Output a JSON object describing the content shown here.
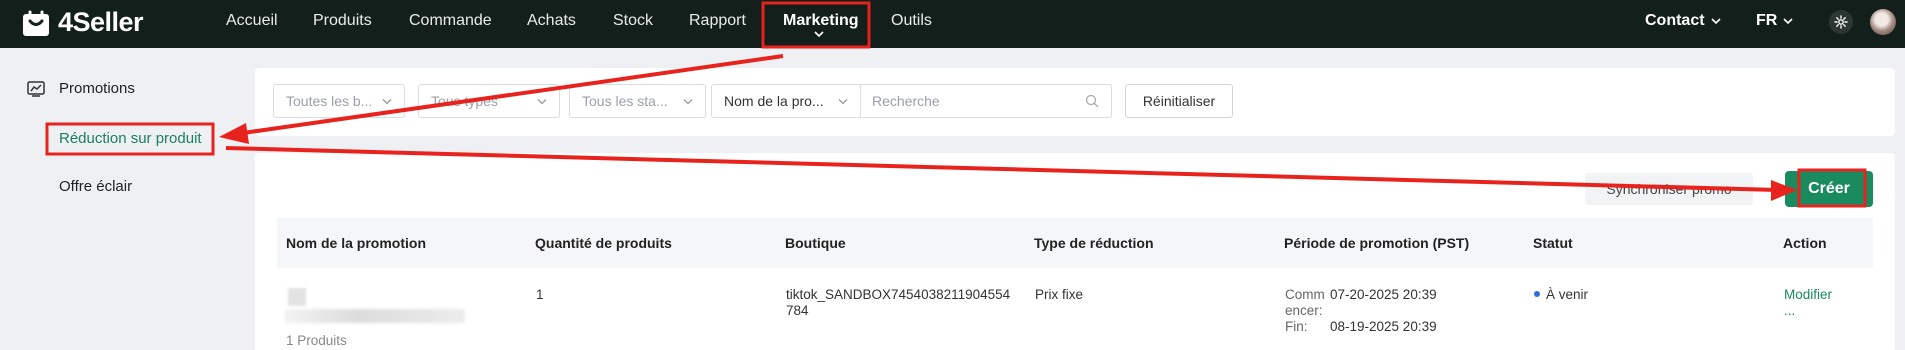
{
  "header": {
    "brand": "4Seller",
    "nav": [
      "Accueil",
      "Produits",
      "Commande",
      "Achats",
      "Stock",
      "Rapport",
      "Marketing",
      "Outils"
    ],
    "active_nav": "Marketing",
    "contact": "Contact",
    "language": "FR"
  },
  "sidebar": {
    "section": "Promotions",
    "items": [
      "Réduction sur produit",
      "Offre éclair"
    ],
    "active": "Réduction sur produit"
  },
  "filters": {
    "shops": "Toutes les b...",
    "types": "Tous types",
    "status": "Tous les sta...",
    "search_field": "Nom de la pro...",
    "search_placeholder": "Recherche",
    "reset": "Réinitialiser"
  },
  "toolbar": {
    "sync": "Synchroniser promo",
    "create": "Créer"
  },
  "table": {
    "columns": [
      "Nom de la promotion",
      "Quantité de produits",
      "Boutique",
      "Type de réduction",
      "Période de promotion (PST)",
      "Statut",
      "Action"
    ],
    "rows": [
      {
        "products_note": "1 Produits",
        "quantity": "1",
        "shop_line1": "tiktok_SANDBOX7454038211904554",
        "shop_line2": "784",
        "discount_type": "Prix fixe",
        "start_label_1": "Comm",
        "start_label_2": "encer:",
        "start": "07-20-2025 20:39",
        "end_label": "Fin:",
        "end": "08-19-2025 20:39",
        "status": "À venir",
        "action": "Modifier",
        "more": "..."
      }
    ]
  },
  "colors": {
    "nav_bg": "#121f1a",
    "accent": "#1a8a5f",
    "annotation": "#e8231d",
    "status_dot": "#2f6fe0"
  }
}
